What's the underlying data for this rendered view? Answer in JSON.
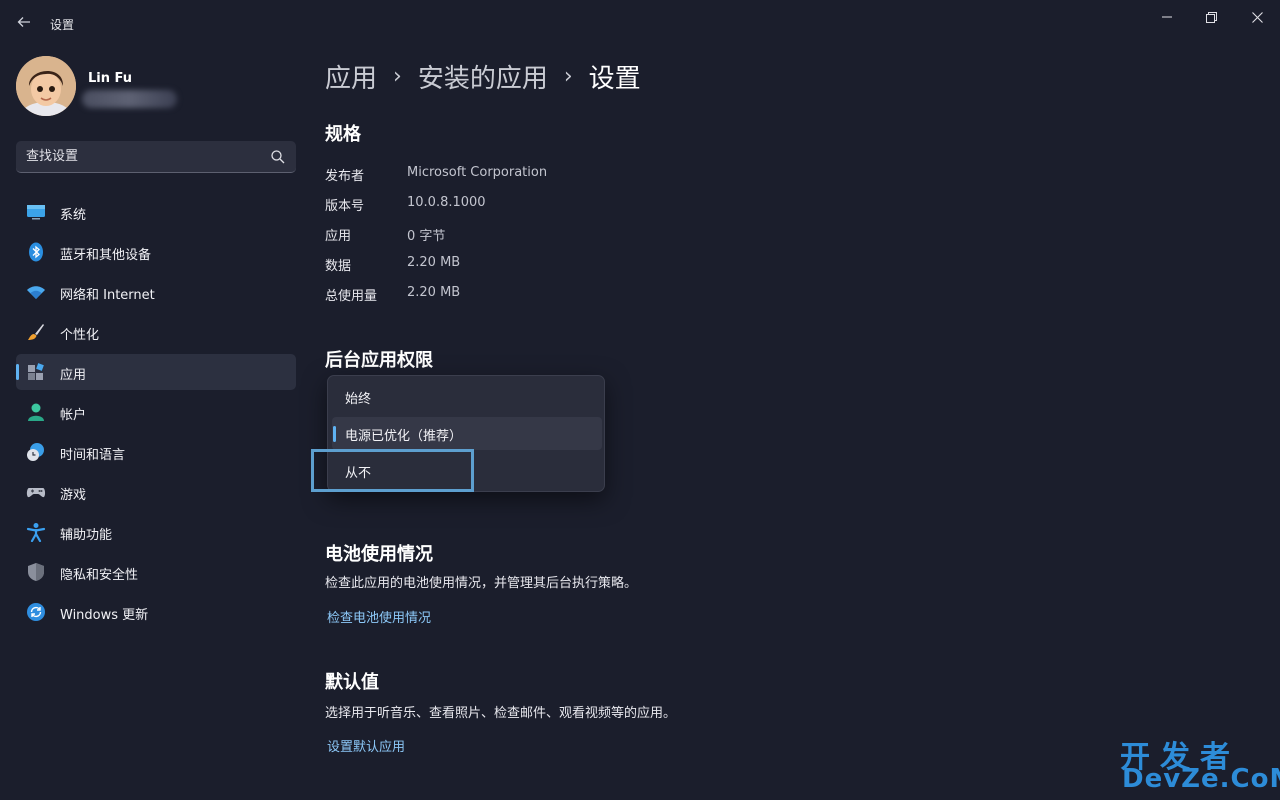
{
  "window": {
    "title": "设置"
  },
  "profile": {
    "name": "Lin Fu"
  },
  "search": {
    "placeholder": "查找设置"
  },
  "sidebar": {
    "items": [
      {
        "label": "系统",
        "icon": "monitor-icon"
      },
      {
        "label": "蓝牙和其他设备",
        "icon": "bluetooth-icon"
      },
      {
        "label": "网络和 Internet",
        "icon": "wifi-icon"
      },
      {
        "label": "个性化",
        "icon": "brush-icon"
      },
      {
        "label": "应用",
        "icon": "apps-icon",
        "active": true
      },
      {
        "label": "帐户",
        "icon": "person-icon"
      },
      {
        "label": "时间和语言",
        "icon": "clock-globe-icon"
      },
      {
        "label": "游戏",
        "icon": "gamepad-icon"
      },
      {
        "label": "辅助功能",
        "icon": "accessibility-icon"
      },
      {
        "label": "隐私和安全性",
        "icon": "shield-icon"
      },
      {
        "label": "Windows 更新",
        "icon": "update-icon"
      }
    ]
  },
  "breadcrumb": {
    "items": [
      "应用",
      "安装的应用",
      "设置"
    ],
    "separator": "›"
  },
  "specs": {
    "title": "规格",
    "rows": [
      {
        "key": "发布者",
        "value": "Microsoft Corporation"
      },
      {
        "key": "版本号",
        "value": "10.0.8.1000"
      },
      {
        "key": "应用",
        "value": "0 字节"
      },
      {
        "key": "数据",
        "value": "2.20 MB"
      },
      {
        "key": "总使用量",
        "value": "2.20 MB"
      }
    ]
  },
  "background": {
    "title": "后台应用权限",
    "options": [
      "始终",
      "电源已优化（推荐）",
      "从不"
    ],
    "selected_index": 1
  },
  "battery": {
    "title": "电池使用情况",
    "description": "检查此应用的电池使用情况，并管理其后台执行策略。",
    "link": "检查电池使用情况"
  },
  "defaults": {
    "title": "默认值",
    "description": "选择用于听音乐、查看照片、检查邮件、观看视频等的应用。",
    "link": "设置默认应用"
  },
  "watermark": {
    "line1": "开发者",
    "line2": "DevZe.CoM"
  },
  "colors": {
    "accent": "#5fb2f2",
    "link": "#8cc8f8",
    "background": "#1b1e2c",
    "highlight": "#5d9fcf"
  }
}
